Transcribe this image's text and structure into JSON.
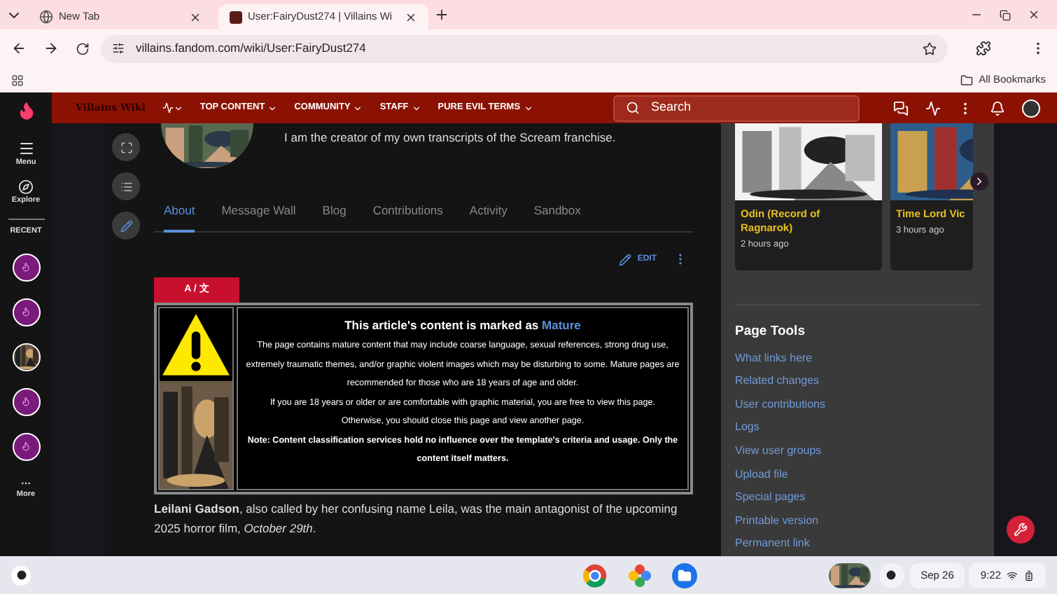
{
  "browser": {
    "tabs": [
      {
        "title": "New Tab",
        "selected": false
      },
      {
        "title": "User:FairyDust274 | Villains Wi",
        "selected": true
      }
    ],
    "address": "villains.fandom.com/wiki/User:FairyDust274",
    "bookmarks": "All Bookmarks"
  },
  "wiki_nav": {
    "wiki_name": "Villains Wiki",
    "menus": [
      "TOP CONTENT",
      "COMMUNITY",
      "STAFF",
      "PURE EVIL TERMS"
    ],
    "search_placeholder": "Search"
  },
  "rail": {
    "menu": "Menu",
    "explore": "Explore",
    "recent_label": "RECENT",
    "recent": [
      {
        "kind": "icon"
      },
      {
        "kind": "icon"
      },
      {
        "kind": "picture"
      },
      {
        "kind": "icon"
      },
      {
        "kind": "icon"
      }
    ],
    "more": "More"
  },
  "profile": {
    "bio": "I am the creator of my own transcripts of the Scream franchise.",
    "tabs": [
      {
        "label": "About",
        "selected": true
      },
      {
        "label": "Message Wall",
        "selected": false
      },
      {
        "label": "Blog",
        "selected": false
      },
      {
        "label": "Contributions",
        "selected": false
      },
      {
        "label": "Activity",
        "selected": false
      },
      {
        "label": "Sandbox",
        "selected": false
      }
    ],
    "edit": "EDIT",
    "language_button": "A / 文",
    "notice": {
      "title": "This article's content is marked as",
      "title_link": "Mature",
      "paragraphs": [
        "The page contains mature content that may include coarse language, sexual references, strong drug use, extremely traumatic themes, and/or graphic violent images which may be disturbing to some. Mature pages are recommended for those who are 18 years of age and older.",
        "If you are 18 years or older or are comfortable with graphic material, you are free to view this page.",
        "Otherwise, you should close this page and view another page."
      ],
      "note": "Note: Content classification services hold no influence over the template's criteria and usage. Only the content itself matters."
    },
    "intro": "**Leilani Gadson**, also called by her confusing name Leila, was the main antagonist of the upcoming 2025 horror film, *October 29th*."
  },
  "recent_cards": [
    {
      "title": "Odin (Record of Ragnarok)",
      "time": "2 hours ago"
    },
    {
      "title": "Time Lord Vic",
      "time": "3 hours ago"
    }
  ],
  "page_tools": {
    "title": "Page Tools",
    "links": [
      "What links here",
      "Related changes",
      "User contributions",
      "Logs",
      "View user groups",
      "Upload file",
      "Special pages",
      "Printable version",
      "Permanent link"
    ]
  },
  "taskbar": {
    "date": "Sep 26",
    "time": "9:22"
  }
}
